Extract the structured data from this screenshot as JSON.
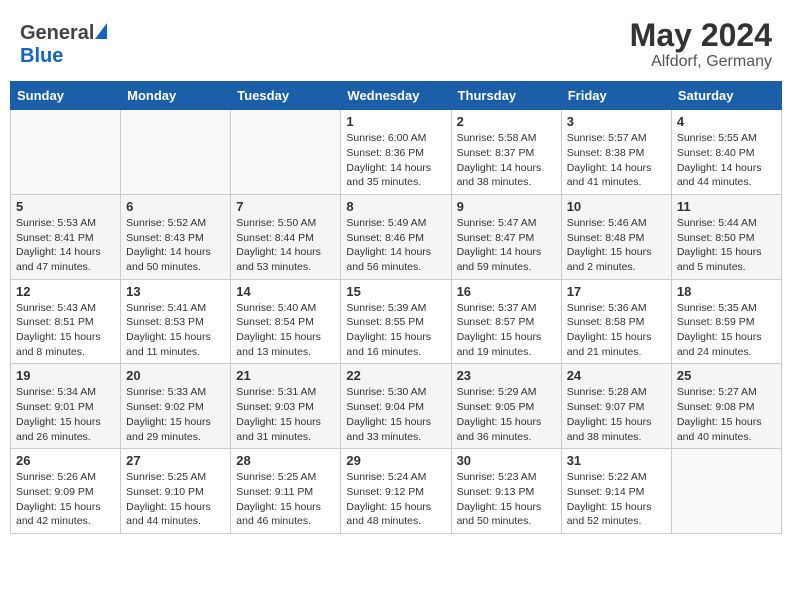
{
  "header": {
    "logo_general": "General",
    "logo_blue": "Blue",
    "month": "May 2024",
    "location": "Alfdorf, Germany"
  },
  "weekdays": [
    "Sunday",
    "Monday",
    "Tuesday",
    "Wednesday",
    "Thursday",
    "Friday",
    "Saturday"
  ],
  "weeks": [
    [
      {
        "day": "",
        "sunrise": "",
        "sunset": "",
        "daylight": ""
      },
      {
        "day": "",
        "sunrise": "",
        "sunset": "",
        "daylight": ""
      },
      {
        "day": "",
        "sunrise": "",
        "sunset": "",
        "daylight": ""
      },
      {
        "day": "1",
        "sunrise": "Sunrise: 6:00 AM",
        "sunset": "Sunset: 8:36 PM",
        "daylight": "Daylight: 14 hours and 35 minutes."
      },
      {
        "day": "2",
        "sunrise": "Sunrise: 5:58 AM",
        "sunset": "Sunset: 8:37 PM",
        "daylight": "Daylight: 14 hours and 38 minutes."
      },
      {
        "day": "3",
        "sunrise": "Sunrise: 5:57 AM",
        "sunset": "Sunset: 8:38 PM",
        "daylight": "Daylight: 14 hours and 41 minutes."
      },
      {
        "day": "4",
        "sunrise": "Sunrise: 5:55 AM",
        "sunset": "Sunset: 8:40 PM",
        "daylight": "Daylight: 14 hours and 44 minutes."
      }
    ],
    [
      {
        "day": "5",
        "sunrise": "Sunrise: 5:53 AM",
        "sunset": "Sunset: 8:41 PM",
        "daylight": "Daylight: 14 hours and 47 minutes."
      },
      {
        "day": "6",
        "sunrise": "Sunrise: 5:52 AM",
        "sunset": "Sunset: 8:43 PM",
        "daylight": "Daylight: 14 hours and 50 minutes."
      },
      {
        "day": "7",
        "sunrise": "Sunrise: 5:50 AM",
        "sunset": "Sunset: 8:44 PM",
        "daylight": "Daylight: 14 hours and 53 minutes."
      },
      {
        "day": "8",
        "sunrise": "Sunrise: 5:49 AM",
        "sunset": "Sunset: 8:46 PM",
        "daylight": "Daylight: 14 hours and 56 minutes."
      },
      {
        "day": "9",
        "sunrise": "Sunrise: 5:47 AM",
        "sunset": "Sunset: 8:47 PM",
        "daylight": "Daylight: 14 hours and 59 minutes."
      },
      {
        "day": "10",
        "sunrise": "Sunrise: 5:46 AM",
        "sunset": "Sunset: 8:48 PM",
        "daylight": "Daylight: 15 hours and 2 minutes."
      },
      {
        "day": "11",
        "sunrise": "Sunrise: 5:44 AM",
        "sunset": "Sunset: 8:50 PM",
        "daylight": "Daylight: 15 hours and 5 minutes."
      }
    ],
    [
      {
        "day": "12",
        "sunrise": "Sunrise: 5:43 AM",
        "sunset": "Sunset: 8:51 PM",
        "daylight": "Daylight: 15 hours and 8 minutes."
      },
      {
        "day": "13",
        "sunrise": "Sunrise: 5:41 AM",
        "sunset": "Sunset: 8:53 PM",
        "daylight": "Daylight: 15 hours and 11 minutes."
      },
      {
        "day": "14",
        "sunrise": "Sunrise: 5:40 AM",
        "sunset": "Sunset: 8:54 PM",
        "daylight": "Daylight: 15 hours and 13 minutes."
      },
      {
        "day": "15",
        "sunrise": "Sunrise: 5:39 AM",
        "sunset": "Sunset: 8:55 PM",
        "daylight": "Daylight: 15 hours and 16 minutes."
      },
      {
        "day": "16",
        "sunrise": "Sunrise: 5:37 AM",
        "sunset": "Sunset: 8:57 PM",
        "daylight": "Daylight: 15 hours and 19 minutes."
      },
      {
        "day": "17",
        "sunrise": "Sunrise: 5:36 AM",
        "sunset": "Sunset: 8:58 PM",
        "daylight": "Daylight: 15 hours and 21 minutes."
      },
      {
        "day": "18",
        "sunrise": "Sunrise: 5:35 AM",
        "sunset": "Sunset: 8:59 PM",
        "daylight": "Daylight: 15 hours and 24 minutes."
      }
    ],
    [
      {
        "day": "19",
        "sunrise": "Sunrise: 5:34 AM",
        "sunset": "Sunset: 9:01 PM",
        "daylight": "Daylight: 15 hours and 26 minutes."
      },
      {
        "day": "20",
        "sunrise": "Sunrise: 5:33 AM",
        "sunset": "Sunset: 9:02 PM",
        "daylight": "Daylight: 15 hours and 29 minutes."
      },
      {
        "day": "21",
        "sunrise": "Sunrise: 5:31 AM",
        "sunset": "Sunset: 9:03 PM",
        "daylight": "Daylight: 15 hours and 31 minutes."
      },
      {
        "day": "22",
        "sunrise": "Sunrise: 5:30 AM",
        "sunset": "Sunset: 9:04 PM",
        "daylight": "Daylight: 15 hours and 33 minutes."
      },
      {
        "day": "23",
        "sunrise": "Sunrise: 5:29 AM",
        "sunset": "Sunset: 9:05 PM",
        "daylight": "Daylight: 15 hours and 36 minutes."
      },
      {
        "day": "24",
        "sunrise": "Sunrise: 5:28 AM",
        "sunset": "Sunset: 9:07 PM",
        "daylight": "Daylight: 15 hours and 38 minutes."
      },
      {
        "day": "25",
        "sunrise": "Sunrise: 5:27 AM",
        "sunset": "Sunset: 9:08 PM",
        "daylight": "Daylight: 15 hours and 40 minutes."
      }
    ],
    [
      {
        "day": "26",
        "sunrise": "Sunrise: 5:26 AM",
        "sunset": "Sunset: 9:09 PM",
        "daylight": "Daylight: 15 hours and 42 minutes."
      },
      {
        "day": "27",
        "sunrise": "Sunrise: 5:25 AM",
        "sunset": "Sunset: 9:10 PM",
        "daylight": "Daylight: 15 hours and 44 minutes."
      },
      {
        "day": "28",
        "sunrise": "Sunrise: 5:25 AM",
        "sunset": "Sunset: 9:11 PM",
        "daylight": "Daylight: 15 hours and 46 minutes."
      },
      {
        "day": "29",
        "sunrise": "Sunrise: 5:24 AM",
        "sunset": "Sunset: 9:12 PM",
        "daylight": "Daylight: 15 hours and 48 minutes."
      },
      {
        "day": "30",
        "sunrise": "Sunrise: 5:23 AM",
        "sunset": "Sunset: 9:13 PM",
        "daylight": "Daylight: 15 hours and 50 minutes."
      },
      {
        "day": "31",
        "sunrise": "Sunrise: 5:22 AM",
        "sunset": "Sunset: 9:14 PM",
        "daylight": "Daylight: 15 hours and 52 minutes."
      },
      {
        "day": "",
        "sunrise": "",
        "sunset": "",
        "daylight": ""
      }
    ]
  ]
}
